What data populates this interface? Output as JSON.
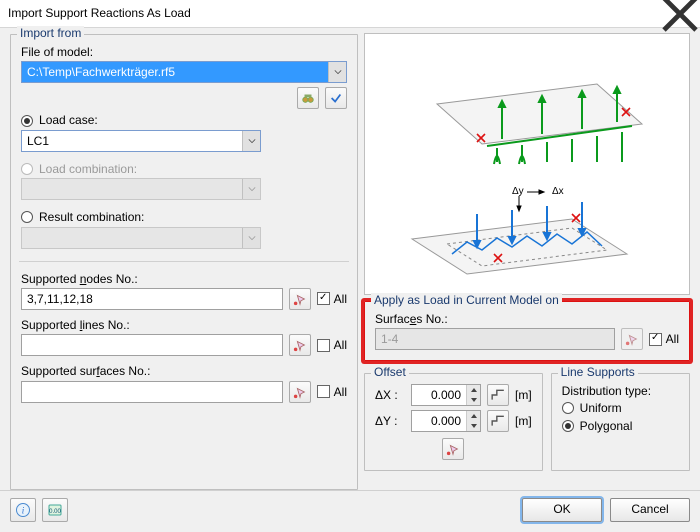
{
  "window": {
    "title": "Import Support Reactions As Load"
  },
  "import_from": {
    "legend": "Import from",
    "file_label": "File of model:",
    "file_value": "C:\\Temp\\Fachwerkträger.rf5",
    "icons": {
      "browse": "binoculars-icon",
      "check": "check-icon"
    },
    "load_case": {
      "label_pre": "L",
      "label_u": "o",
      "label_post": "ad case:",
      "value": "LC1",
      "selected": true
    },
    "load_combination": {
      "label_pre": "Load ",
      "label_u": "c",
      "label_post": "ombination:",
      "value": "",
      "selected": false,
      "disabled": true
    },
    "result_combination": {
      "label_pre": "Re",
      "label_u": "s",
      "label_post": "ult combination:",
      "value": "",
      "selected": false
    },
    "supported_nodes": {
      "label_pre": "Supported ",
      "label_u": "n",
      "label_post": "odes No.:",
      "value": "3,7,11,12,18",
      "all": true
    },
    "supported_lines": {
      "label_pre": "Supported ",
      "label_u": "l",
      "label_post": "ines No.:",
      "value": "",
      "all": false
    },
    "supported_surfaces": {
      "label_pre": "Supported sur",
      "label_u": "f",
      "label_post": "aces No.:",
      "value": "",
      "all": false
    },
    "all_label": "All"
  },
  "apply_on": {
    "legend": "Apply as Load in Current Model on",
    "surfaces_label_pre": "Surfac",
    "surfaces_label_u": "e",
    "surfaces_label_post": "s No.:",
    "value": "1-4",
    "all": true,
    "all_label": "All"
  },
  "offset": {
    "legend": "Offset",
    "dx_label": "ΔX :",
    "dx_value": "0.000",
    "dy_label": "ΔY :",
    "dy_value": "0.000",
    "unit": "[m]"
  },
  "line_supports": {
    "legend": "Line Supports",
    "dist_label": "Distribution type:",
    "uniform": "Uniform",
    "polygonal": "Polygonal",
    "selected": "polygonal"
  },
  "footer": {
    "ok": "OK",
    "cancel": "Cancel"
  }
}
